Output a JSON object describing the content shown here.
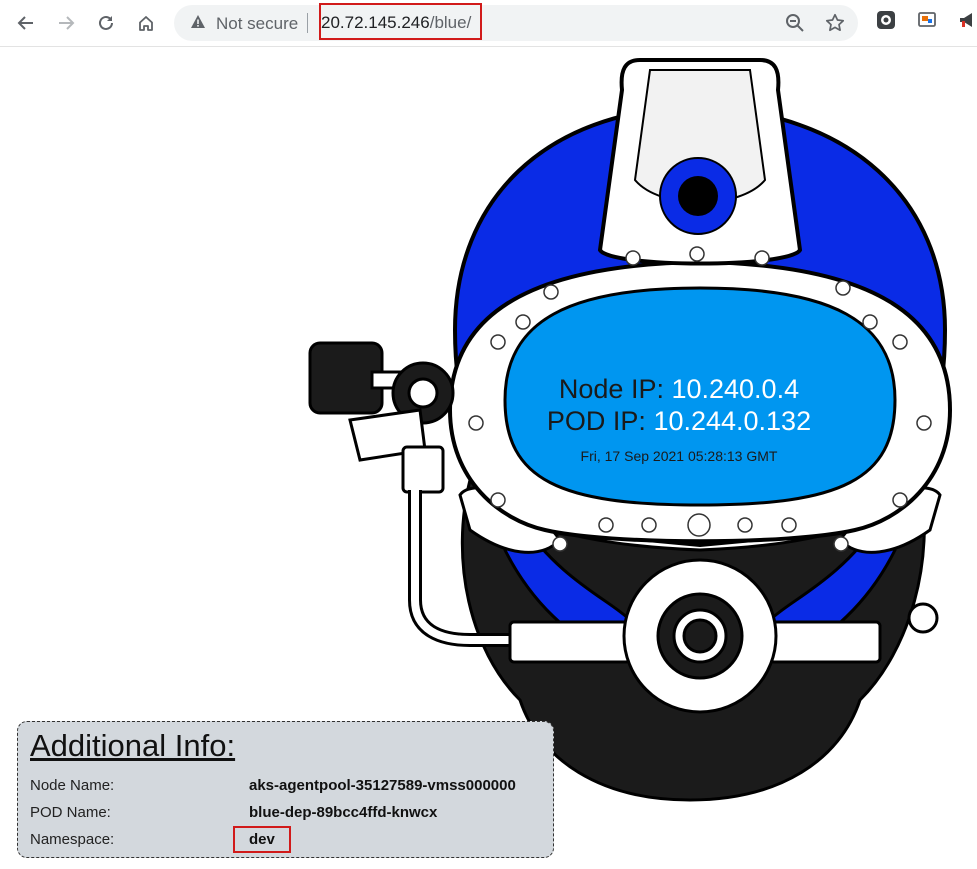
{
  "browser": {
    "security_label": "Not secure",
    "url_host": "20.72.145.246",
    "url_path": "/blue/",
    "icons": {
      "back": "arrow-left-icon",
      "forward": "arrow-right-icon",
      "reload": "reload-icon",
      "home": "home-icon",
      "warning": "warning-triangle-icon",
      "zoom": "zoom-out-icon",
      "bookmark": "star-icon"
    },
    "highlight_color": "#d11a1a"
  },
  "visor": {
    "node_ip_label": "Node IP:",
    "node_ip_value": "10.240.0.4",
    "pod_ip_label": "POD IP:",
    "pod_ip_value": "10.244.0.132",
    "timestamp": "Fri, 17 Sep 2021 05:28:13 GMT",
    "visor_color": "#0096f0",
    "helmet_color": "#0a2be6"
  },
  "info": {
    "title": "Additional Info:",
    "rows": [
      {
        "label": "Node Name:",
        "value": "aks-agentpool-35127589-vmss000000"
      },
      {
        "label": "POD Name:",
        "value": "blue-dep-89bcc4ffd-knwcx"
      },
      {
        "label": "Namespace:",
        "value": "dev"
      }
    ],
    "panel_color": "#d3d8dd"
  }
}
